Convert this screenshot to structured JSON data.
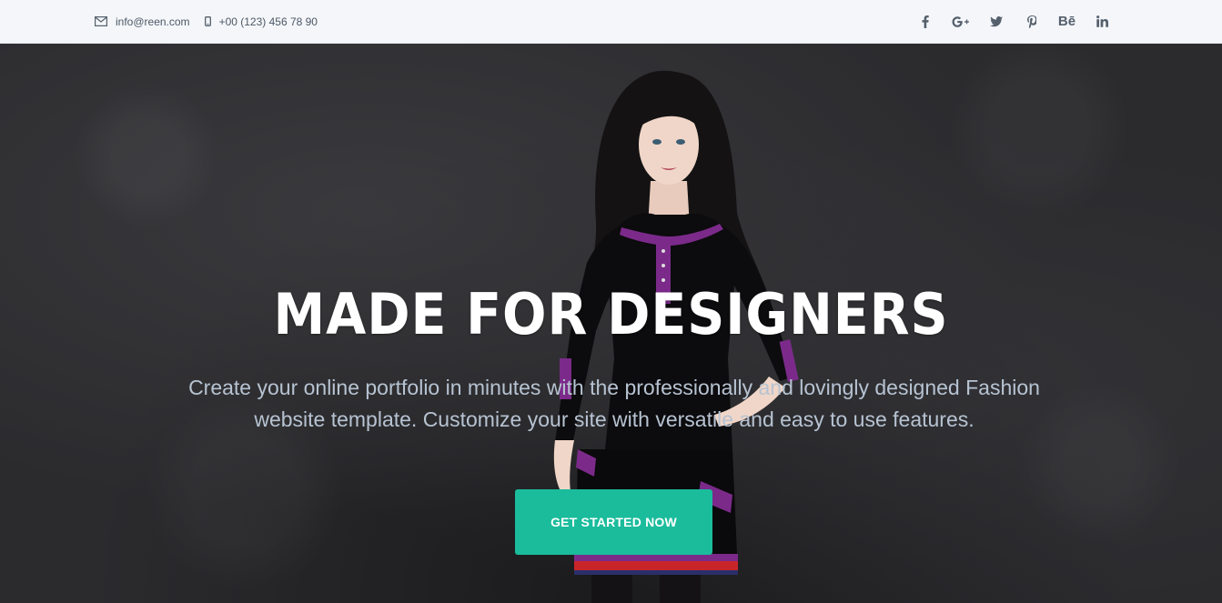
{
  "topbar": {
    "email": "info@reen.com",
    "phone": "+00 (123) 456 78 90",
    "social": [
      {
        "name": "facebook-icon",
        "glyph": "f"
      },
      {
        "name": "google-plus-icon",
        "glyph": "G+"
      },
      {
        "name": "twitter-icon",
        "glyph": ""
      },
      {
        "name": "pinterest-icon",
        "glyph": "P"
      },
      {
        "name": "behance-icon",
        "glyph": "Bē"
      },
      {
        "name": "linkedin-icon",
        "glyph": "in"
      }
    ]
  },
  "hero": {
    "title": "MADE FOR DESIGNERS",
    "subtitle": "Create your online portfolio in minutes with the professionally and lovingly designed Fashion website template. Customize your site with versatile and easy to use features.",
    "cta_label": "GET STARTED NOW"
  },
  "colors": {
    "accent": "#1abc9c",
    "topbar_bg": "#f4f6f9",
    "hero_bg": "#2b2b2e",
    "subtitle_text": "#b7c3d2"
  }
}
